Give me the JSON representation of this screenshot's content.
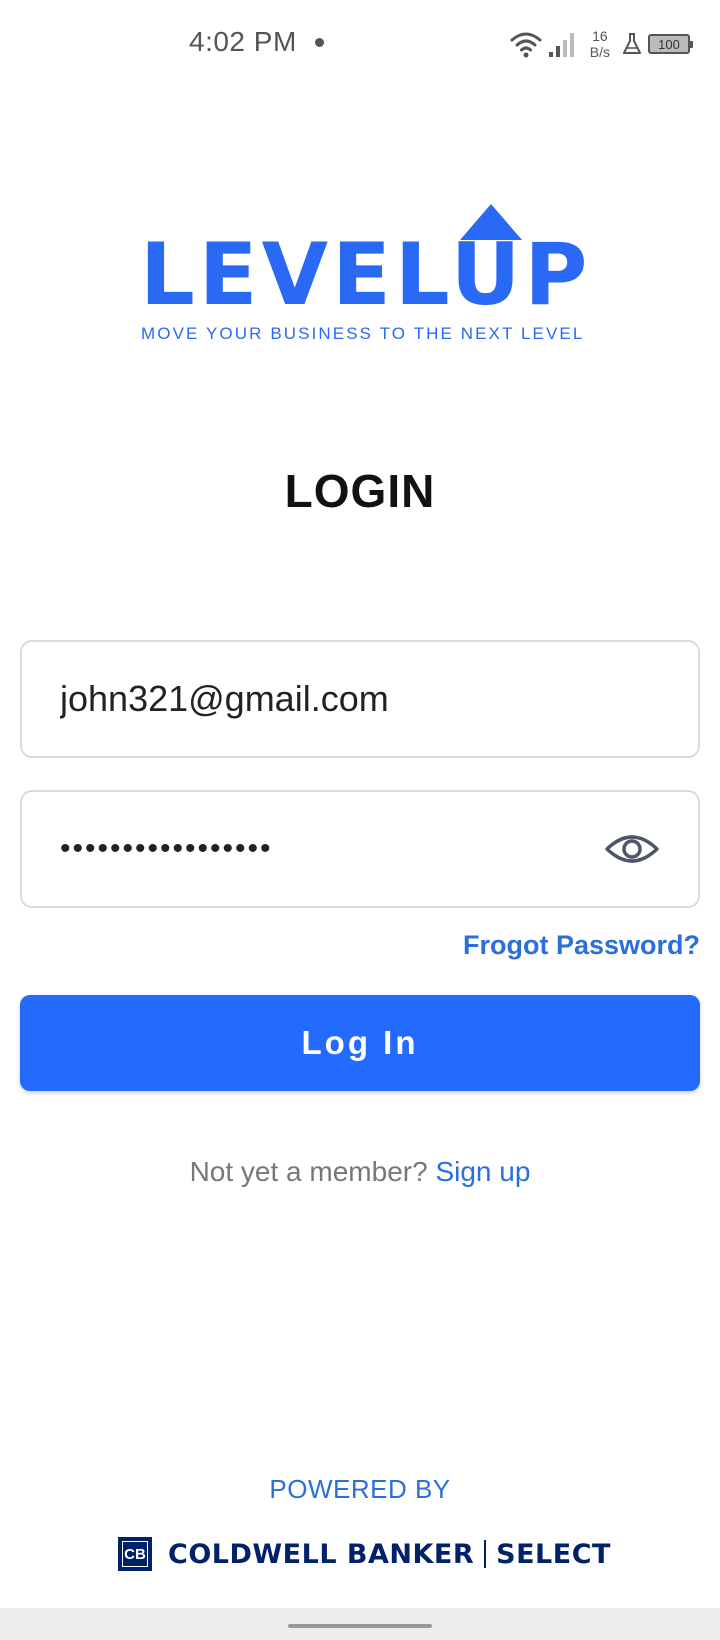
{
  "status_bar": {
    "time": "4:02 PM",
    "net_speed_value": "16",
    "net_speed_unit": "B/s",
    "battery": "100",
    "icons": [
      "wifi-icon",
      "signal-icon",
      "flask-icon",
      "battery-icon"
    ]
  },
  "logo": {
    "wordmark": "LEVELUP",
    "tagline": "MOVE YOUR BUSINESS TO THE NEXT LEVEL",
    "color": "#2a68f6"
  },
  "login": {
    "title": "LOGIN",
    "email_value": "john321@gmail.com",
    "password_value": "•••••••••••••••••",
    "forgot_label": "Frogot Password?",
    "button_label": "Log In",
    "signup_prompt": "Not yet a member?",
    "signup_link": "Sign up"
  },
  "footer": {
    "powered_by": "POWERED BY",
    "brand_mark": "CB",
    "brand_name": "COLDWELL BANKER",
    "brand_suffix": "SELECT",
    "brand_color": "#012169"
  },
  "colors": {
    "accent": "#236bfe",
    "link": "#2a6fdb"
  }
}
